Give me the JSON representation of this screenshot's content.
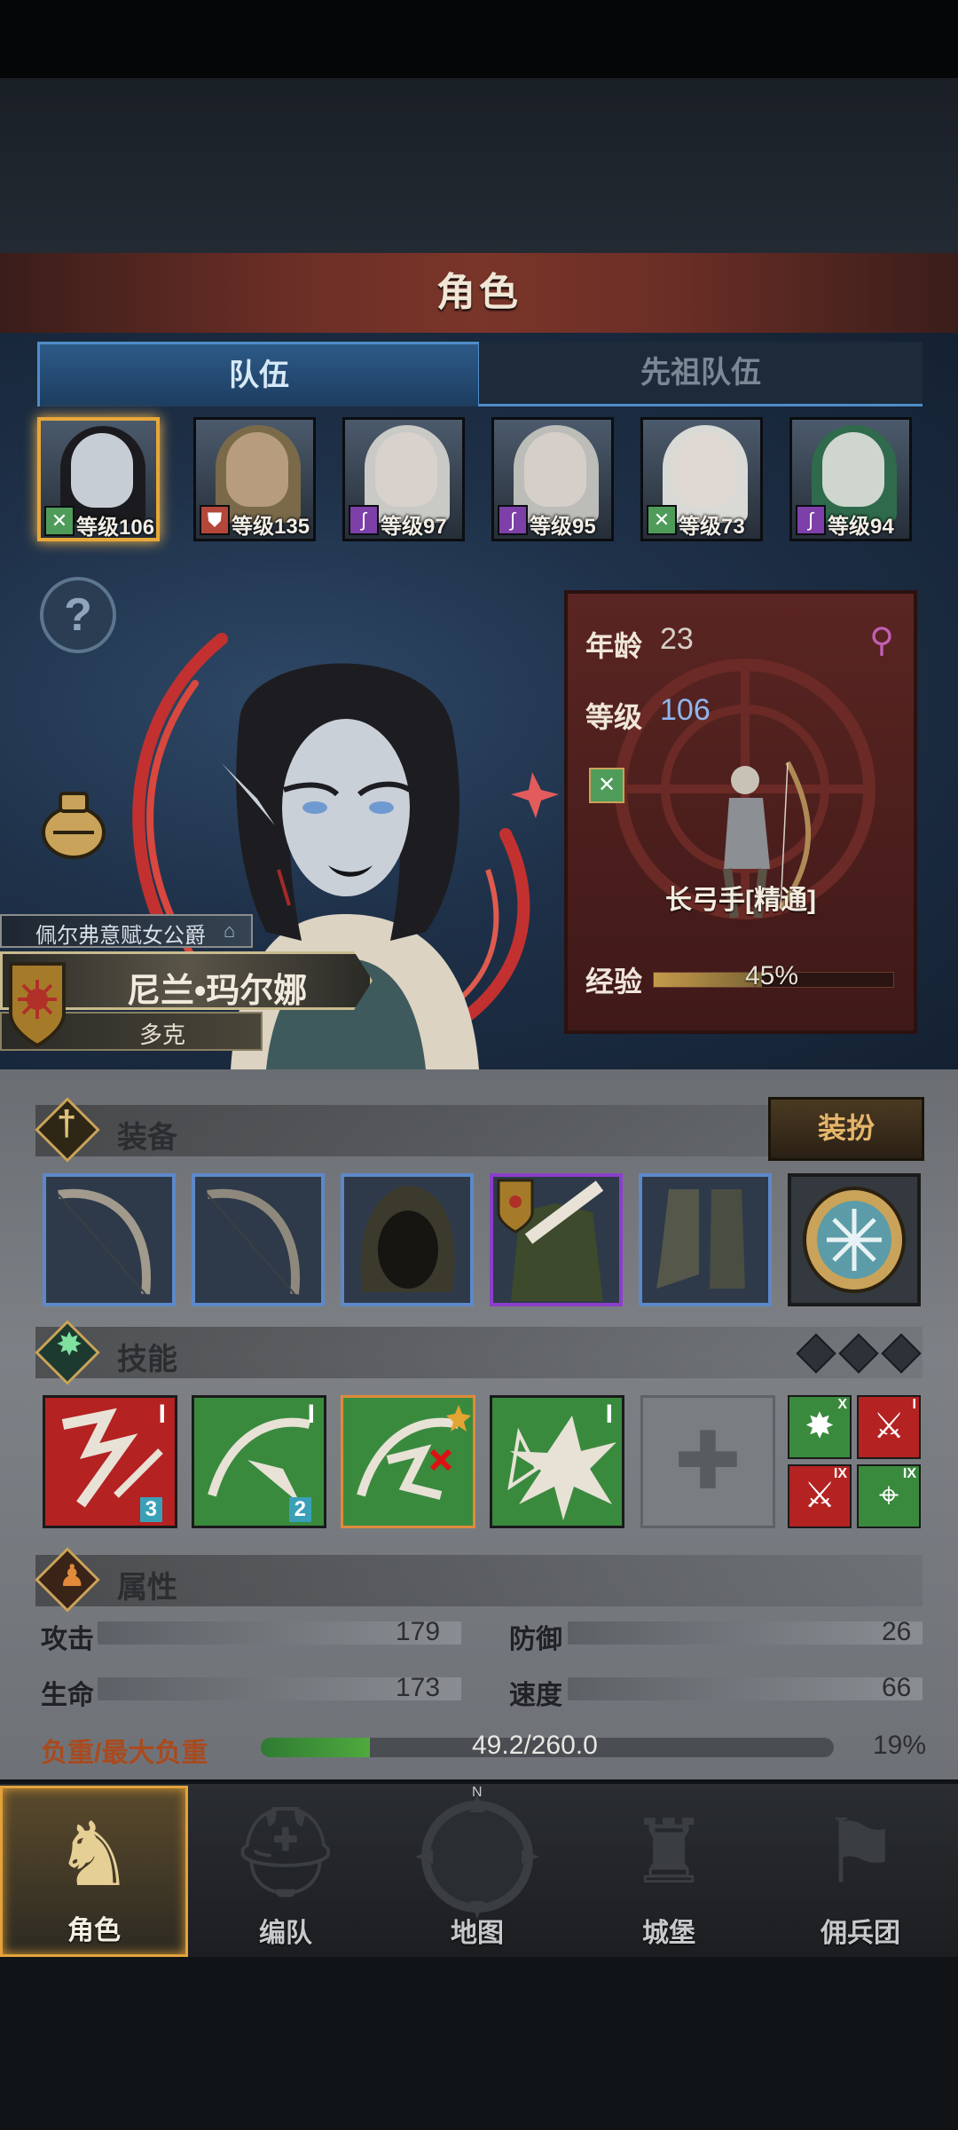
{
  "header": {
    "title": "角色"
  },
  "tabs": [
    {
      "label": "队伍",
      "active": true
    },
    {
      "label": "先祖队伍",
      "active": false
    }
  ],
  "party": [
    {
      "level_text": "等级106",
      "class_icon": "bow-icon",
      "badge_color": "#4f9c5a",
      "selected": true
    },
    {
      "level_text": "等级135",
      "class_icon": "shield-icon",
      "badge_color": "#b4473a",
      "selected": false
    },
    {
      "level_text": "等级97",
      "class_icon": "staff-icon",
      "badge_color": "#7d3fa8",
      "selected": false
    },
    {
      "level_text": "等级95",
      "class_icon": "staff-icon",
      "badge_color": "#7d3fa8",
      "selected": false
    },
    {
      "level_text": "等级73",
      "class_icon": "bow-icon",
      "badge_color": "#4f9c5a",
      "selected": false
    },
    {
      "level_text": "等级94",
      "class_icon": "staff-icon",
      "badge_color": "#7d3fa8",
      "selected": false
    }
  ],
  "character": {
    "title": "佩尔弗意赋女公爵",
    "name": "尼兰•玛尔娜",
    "origin": "多克",
    "age_label": "年龄",
    "age": "23",
    "level_label": "等级",
    "level": "106",
    "class_name": "长弓手[精通]",
    "exp_label": "经验",
    "exp_text": "45%",
    "exp_fraction": 0.45,
    "gender_icon": "female-icon"
  },
  "equipment": {
    "label": "装备",
    "dress_button": "装扮",
    "slots": [
      {
        "name": "longbow",
        "border": "#5d88c9"
      },
      {
        "name": "longbow",
        "border": "#5d88c9"
      },
      {
        "name": "hood",
        "border": "#5d88c9"
      },
      {
        "name": "cloak",
        "border": "#8b3fc9"
      },
      {
        "name": "boots",
        "border": "#5d88c9"
      },
      {
        "name": "amulet",
        "border": "#1a1a1a"
      }
    ]
  },
  "skills": {
    "label": "技能",
    "items": [
      {
        "rank": "I",
        "count": "3",
        "color": "#b42222"
      },
      {
        "rank": "I",
        "count": "2",
        "color": "#3a8a3e"
      },
      {
        "rank": "",
        "count": "",
        "color": "#3a8a3e"
      },
      {
        "rank": "I",
        "count": "",
        "color": "#3a8a3e"
      }
    ],
    "small": [
      {
        "rank": "X",
        "color": "#3a8a3e"
      },
      {
        "rank": "I",
        "color": "#b42222"
      },
      {
        "rank": "IX",
        "color": "#b42222"
      },
      {
        "rank": "IX",
        "color": "#3a8a3e"
      }
    ]
  },
  "attributes": {
    "label": "属性",
    "attack_label": "攻击",
    "attack": "179",
    "defense_label": "防御",
    "defense": "26",
    "hp_label": "生命",
    "hp": "173",
    "speed_label": "速度",
    "speed": "66",
    "load_label": "负重/最大负重",
    "load": "49.2/260.0",
    "load_pct": "19%",
    "load_fraction": 0.19
  },
  "nav": [
    {
      "label": "角色",
      "active": true
    },
    {
      "label": "编队",
      "active": false
    },
    {
      "label": "地图",
      "active": false
    },
    {
      "label": "城堡",
      "active": false
    },
    {
      "label": "佣兵团",
      "active": false
    }
  ],
  "colors": {
    "accent": "#e3a23a",
    "level_blue": "#8fb6f0",
    "tab_blue": "#4f8dc9"
  }
}
